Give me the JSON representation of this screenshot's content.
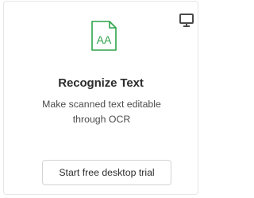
{
  "tool_card": {
    "desktop_icon": "desktop-computer-icon",
    "tool_icon": "recognize-text-document-icon",
    "tool_icon_glyph": "AA",
    "title": "Recognize Text",
    "description": "Make scanned text editable through OCR",
    "cta_label": "Start free desktop trial"
  },
  "colors": {
    "accent_green": "#2da44a",
    "card_border": "#e6e6e6",
    "text_primary": "#2c2c2c",
    "text_secondary": "#4b4b4b"
  }
}
